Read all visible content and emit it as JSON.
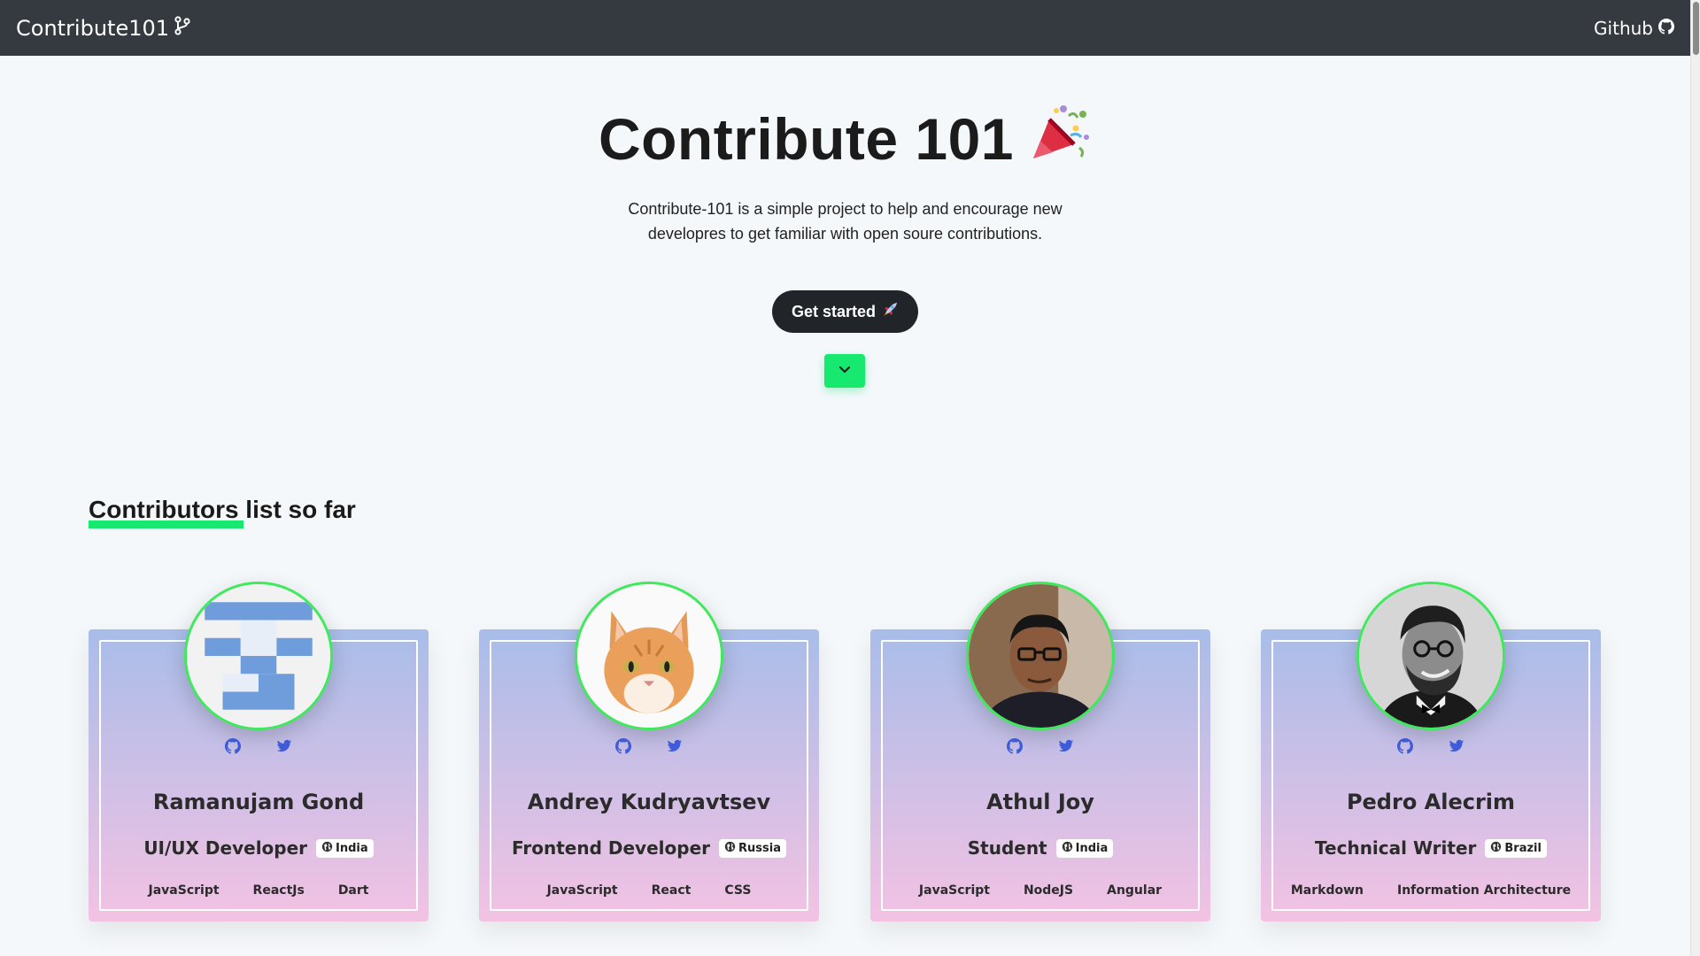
{
  "nav": {
    "brand": "Contribute101",
    "github_label": "Github"
  },
  "hero": {
    "title": "Contribute 101",
    "description": "Contribute-101 is a simple project to help and encourage new developres to get familiar with open soure contributions.",
    "cta_label": "Get started"
  },
  "section": {
    "title_underlined": "Contributors",
    "title_rest": " list so far"
  },
  "contributors": [
    {
      "name": "Ramanujam Gond",
      "role": "UI/UX Developer",
      "country": "India",
      "skills": [
        "JavaScript",
        "ReactJs",
        "Dart"
      ]
    },
    {
      "name": "Andrey Kudryavtsev",
      "role": "Frontend Developer",
      "country": "Russia",
      "skills": [
        "JavaScript",
        "React",
        "CSS"
      ]
    },
    {
      "name": "Athul Joy",
      "role": "Student",
      "country": "India",
      "skills": [
        "JavaScript",
        "NodeJS",
        "Angular"
      ]
    },
    {
      "name": "Pedro Alecrim",
      "role": "Technical Writer",
      "country": "Brazil",
      "skills": [
        "Markdown",
        "Information Architecture"
      ]
    }
  ],
  "colors": {
    "navbar": "#343a40",
    "accent_green": "#17e86f",
    "icon_blue": "#3f5bd8"
  },
  "icons": [
    "git-branch-icon",
    "github-icon",
    "party-popper-icon",
    "rocket-icon",
    "chevron-down-icon",
    "twitter-icon",
    "globe-icon"
  ]
}
